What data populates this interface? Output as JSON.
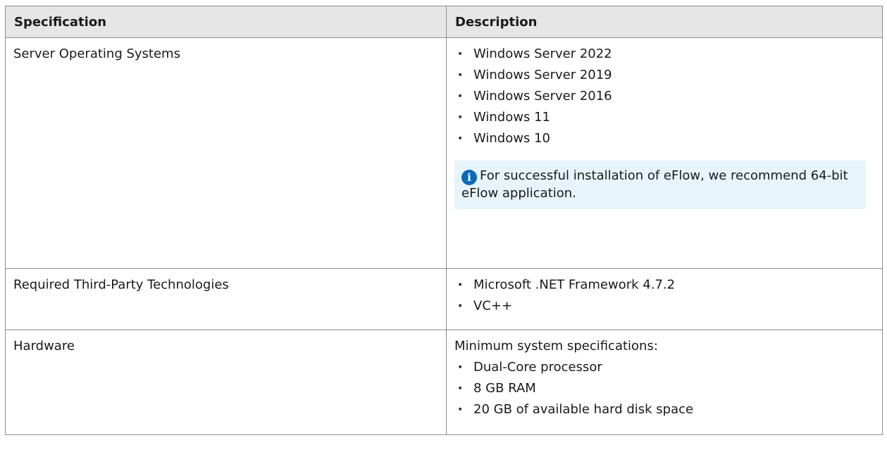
{
  "table": {
    "headers": [
      "Specification",
      "Description"
    ],
    "rows": [
      {
        "spec": "Server Operating Systems",
        "items": [
          "Windows Server 2022",
          "Windows Server 2019",
          "Windows Server 2016",
          "Windows 11",
          "Windows 10"
        ],
        "note": "For successful installation of eFlow, we recommend 64-bit eFlow application."
      },
      {
        "spec": "Required Third-Party Technologies",
        "items": [
          "Microsoft .NET Framework 4.7.2",
          "VC++"
        ]
      },
      {
        "spec": "Hardware",
        "intro": "Minimum system specifications:",
        "items": [
          "Dual-Core processor",
          "8 GB RAM",
          "20 GB of available hard disk space"
        ]
      }
    ]
  },
  "icons": {
    "bullet": "•",
    "info": "i"
  },
  "colors": {
    "header_bg": "#e6e6e6",
    "note_bg": "#e8f4fc",
    "info_icon": "#0a6ab8",
    "border": "#8c8c8c"
  }
}
